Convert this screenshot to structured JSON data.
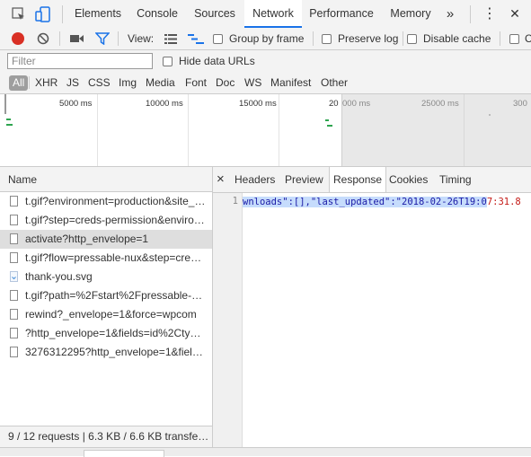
{
  "devtools": {
    "tabs": [
      {
        "label": "Elements"
      },
      {
        "label": "Console"
      },
      {
        "label": "Sources"
      },
      {
        "label": "Network"
      },
      {
        "label": "Performance"
      },
      {
        "label": "Memory"
      }
    ],
    "more_tabs_glyph": "»",
    "kebab_glyph": "⋮",
    "close_glyph": "✕"
  },
  "toolbar": {
    "view_label": "View:",
    "group_by_frame": "Group by frame",
    "preserve_log": "Preserve log",
    "disable_cache": "Disable cache",
    "record_color": "#d93025",
    "filter_active_color": "#1a73e8"
  },
  "filter": {
    "placeholder": "Filter",
    "hide_data_urls": "Hide data URLs",
    "types": [
      "All",
      "XHR",
      "JS",
      "CSS",
      "Img",
      "Media",
      "Font",
      "Doc",
      "WS",
      "Manifest",
      "Other"
    ]
  },
  "overview": {
    "ticks": [
      "5000 ms",
      "10000 ms",
      "15000 ms",
      "20",
      "000 ms",
      "25000 ms",
      "300"
    ]
  },
  "requests": {
    "header": "Name",
    "rows": [
      {
        "name": "t.gif?environment=production&site_…",
        "selected": false,
        "icon": "file-icon"
      },
      {
        "name": "t.gif?step=creds-permission&enviro…",
        "selected": false,
        "icon": "file-icon"
      },
      {
        "name": "activate?http_envelope=1",
        "selected": true,
        "icon": "file-icon"
      },
      {
        "name": "t.gif?flow=pressable-nux&step=cre…",
        "selected": false,
        "icon": "file-icon"
      },
      {
        "name": "thank-you.svg",
        "selected": false,
        "icon": "svg-file-icon"
      },
      {
        "name": "t.gif?path=%2Fstart%2Fpressable-…",
        "selected": false,
        "icon": "file-icon"
      },
      {
        "name": "rewind?_envelope=1&force=wpcom",
        "selected": false,
        "icon": "file-icon"
      },
      {
        "name": "?http_envelope=1&fields=id%2Cty…",
        "selected": false,
        "icon": "file-icon"
      },
      {
        "name": "3276312295?http_envelope=1&fiel…",
        "selected": false,
        "icon": "file-icon"
      }
    ],
    "status": "9 / 12 requests | 6.3 KB / 6.6 KB transfe…"
  },
  "details": {
    "close_glyph": "×",
    "tabs": [
      "Headers",
      "Preview",
      "Response",
      "Cookies",
      "Timing"
    ],
    "active_tab": "Response",
    "line_number": "1",
    "code_key_part": "wnloads\":[],\"last_updated\":\"2018-02-26T19:0",
    "code_tail": "7:31.8"
  }
}
